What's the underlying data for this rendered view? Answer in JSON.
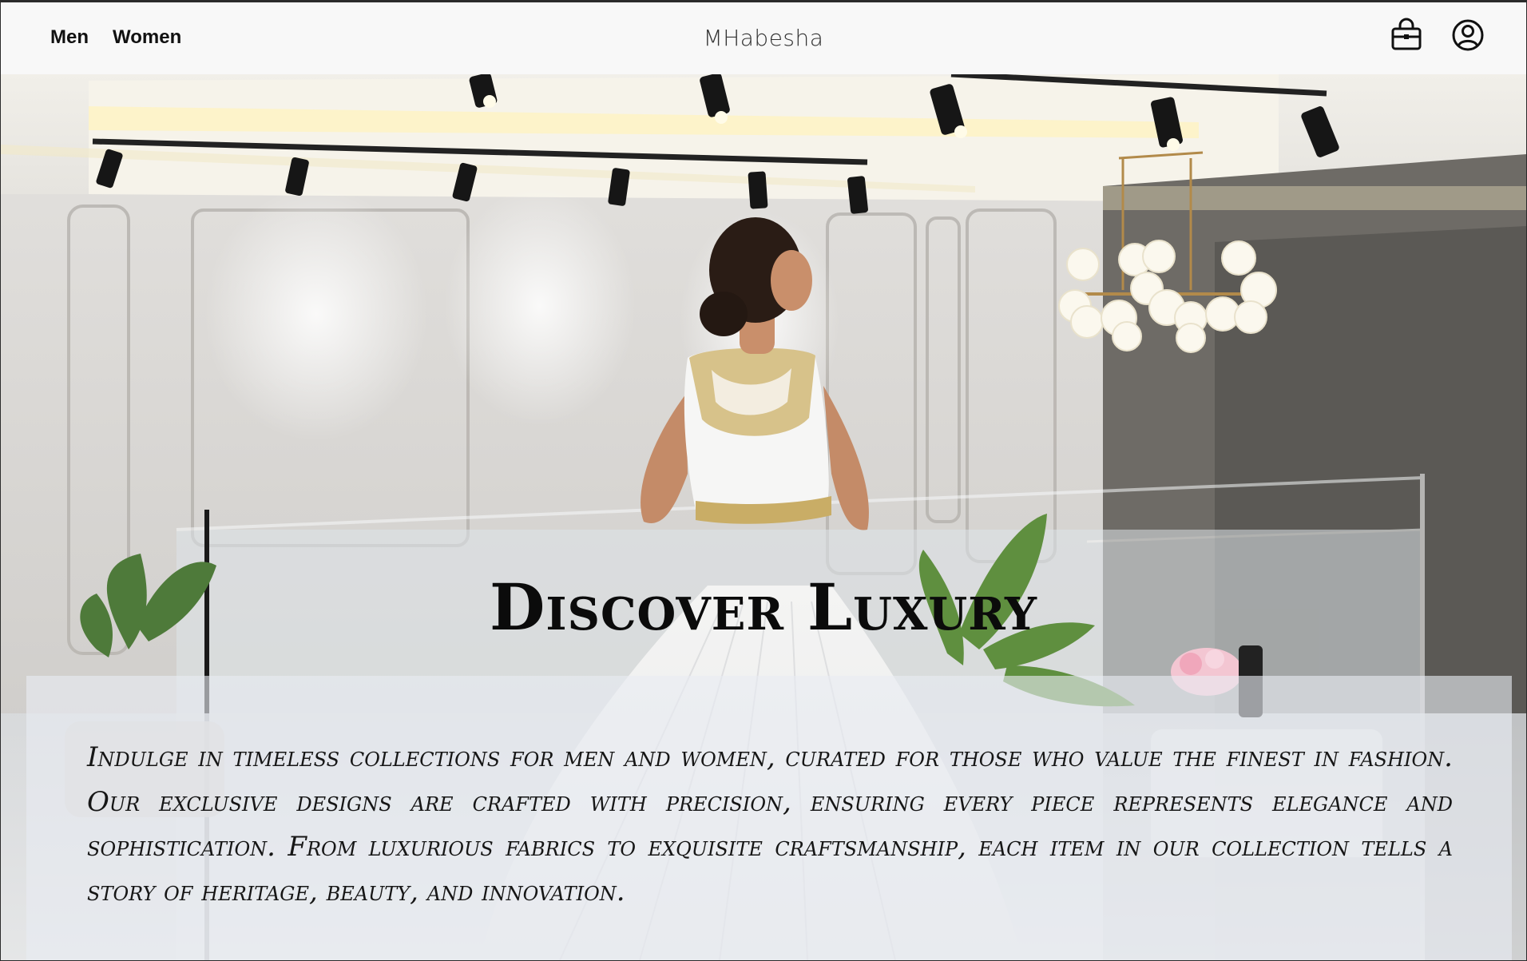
{
  "header": {
    "nav": [
      {
        "label": "Men"
      },
      {
        "label": "Women"
      }
    ],
    "brand": "MHabesha",
    "icons": {
      "bag": "shopping-bag-icon",
      "account": "account-icon"
    }
  },
  "hero": {
    "title": "Discover Luxury",
    "description": "Indulge in timeless collections for men and women, curated for those who value the finest in fashion. Our exclusive designs are crafted with precision, ensuring every piece represents elegance and sophistication. From luxurious fabrics to exquisite craftsmanship, each item in our collection tells a story of heritage, beauty, and innovation."
  },
  "colors": {
    "topbar_bg": "#f8f8f8",
    "text_dark": "#111111",
    "panel_overlay": "#e8ecf2"
  }
}
